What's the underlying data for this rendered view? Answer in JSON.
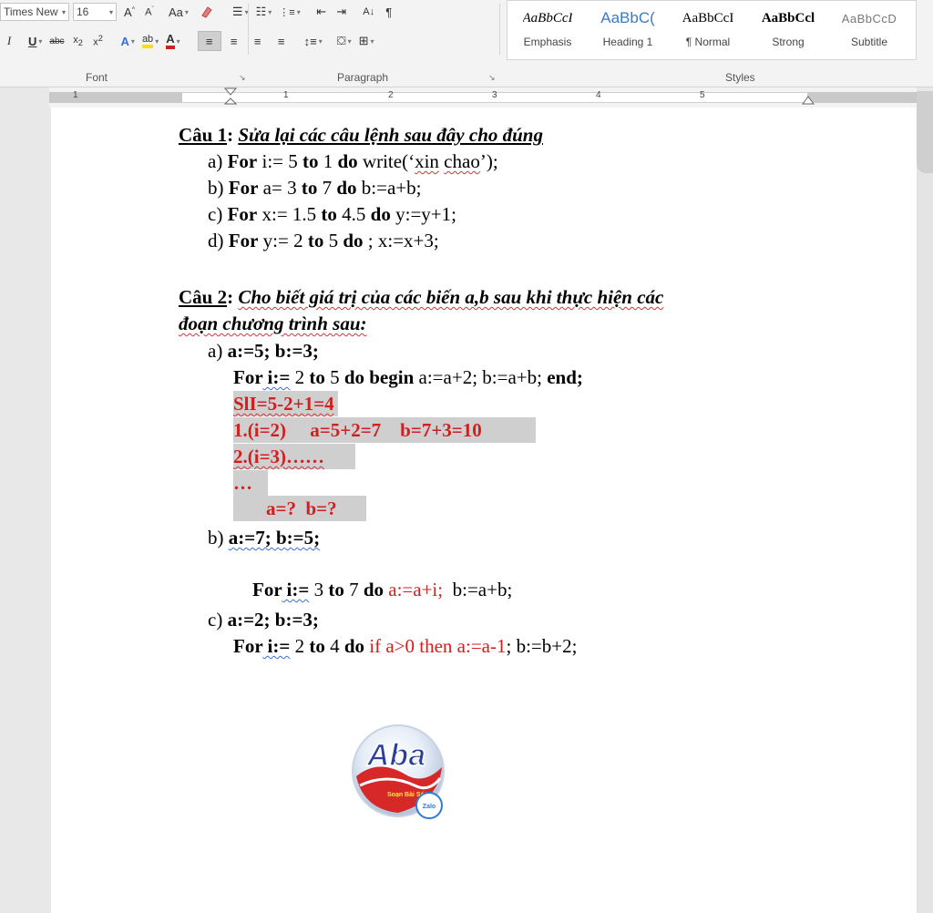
{
  "ribbon": {
    "font_name": "Times New Ro",
    "font_size": "16",
    "font_group_label": "Font",
    "paragraph_group_label": "Paragraph",
    "styles_group_label": "Styles",
    "styles": [
      {
        "sample": "AaBbCcI",
        "name": "Emphasis"
      },
      {
        "sample": "AaBbC(",
        "name": "Heading 1"
      },
      {
        "sample": "AaBbCcI",
        "name": "¶ Normal"
      },
      {
        "sample": "AaBbCcl",
        "name": "Strong"
      },
      {
        "sample": "AaBbCcD",
        "name": "Subtitle"
      }
    ]
  },
  "ruler": {
    "numbers": [
      "1",
      "1",
      "2",
      "3",
      "4",
      "5"
    ]
  },
  "document": {
    "q1_title": "Câu 1",
    "q1_colon": ": ",
    "q1_text": "Sửa lại các câu lệnh sau đây cho đúng",
    "q1_items": {
      "a": {
        "label": "a) ",
        "text1": "For",
        "text2": " i:= 5 ",
        "text3": "to",
        "text4": " 1 ",
        "text5": "do",
        "text6": " write(‘",
        "text7": "xin",
        "text8": " ",
        "text9": "chao",
        "text10": "’);"
      },
      "b": {
        "label": "b) ",
        "text1": "For",
        "text2": " a= 3 ",
        "text3": "to",
        "text4": " 7 ",
        "text5": "do",
        "text6": " b:=a+b;"
      },
      "c": {
        "label": "c) ",
        "text1": "For",
        "text2": " x:= 1.5 ",
        "text3": "to",
        "text4": " 4.5 ",
        "text5": "do",
        "text6": " y:=y+1;"
      },
      "d": {
        "label": "d) ",
        "text1": "For",
        "text2": " y:= 2 ",
        "text3": "to",
        "text4": " 5 ",
        "text5": "do",
        "text6": " ; x:=x+3;"
      }
    },
    "q2_title": "Câu 2",
    "q2_colon": ": ",
    "q2_text_line1": "Cho biết giá trị của các biến a,b sau khi thực hiện các",
    "q2_text_line2": "đoạn chương trình sau:",
    "q2a": {
      "label": "a) ",
      "init": "a:=5; b:=3;",
      "for": "For",
      "var": " i:=",
      "range1": " 2 ",
      "to": "to",
      "range2": " 5 ",
      "do_begin": "do begin",
      "body": " a:=a+2; b:=a+b; ",
      "end": "end;",
      "ans1": "SlI=5-2+1=4",
      "ans2": "1.(i=2)     a=5+2=7    b=7+3=10",
      "ans3": "2.(i=3)……",
      "ans4": "…",
      "ans5": "a=?  b=?"
    },
    "q2b": {
      "label": "b) ",
      "init": "a:=7; b:=5;",
      "for": "For",
      "var": " i:=",
      "range1": " 3 ",
      "to": "to",
      "range2": " 7 ",
      "do": "do",
      "red_part": " a:=a+i;",
      "tail": "  b:=a+b;"
    },
    "q2c": {
      "label": "c) ",
      "init": "a:=2; b:=3;",
      "for": "For",
      "var": " i:=",
      "range1": " 2 ",
      "to": "to",
      "range2": " 4 ",
      "do": "do",
      "red_part": " if a>0 then a:=a-1",
      "tail": "; b:=b+2;"
    }
  },
  "logo": {
    "text": "Aba",
    "badge": "Zalo",
    "tagline": "Soạn Bài Sớm"
  },
  "colors": {
    "accent_red": "#d11f1f",
    "highlight": "#cfcfcf"
  }
}
